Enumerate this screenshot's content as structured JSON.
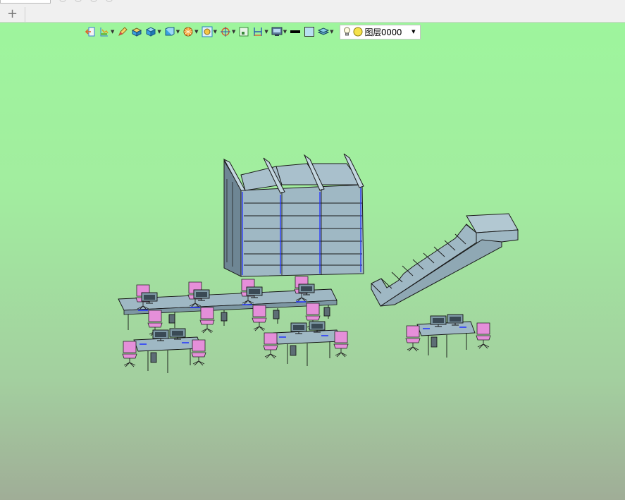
{
  "tabs": {
    "new_tab_label": "+"
  },
  "toolbar": {
    "tools": [
      {
        "icon": "exit-sketch-icon",
        "dropdown": false
      },
      {
        "icon": "feature-tree-icon",
        "dropdown": true
      },
      {
        "icon": "pencil-icon",
        "dropdown": false
      },
      {
        "icon": "box-icon",
        "dropdown": false
      },
      {
        "icon": "solid-cube-icon",
        "dropdown": true
      },
      {
        "icon": "view-cube-icon",
        "dropdown": true
      },
      {
        "icon": "render-sphere-icon",
        "dropdown": true
      },
      {
        "icon": "zoom-fit-icon",
        "dropdown": true
      },
      {
        "icon": "snap-target-icon",
        "dropdown": true
      },
      {
        "icon": "grid-icon",
        "dropdown": false
      },
      {
        "icon": "dimension-icon",
        "dropdown": true
      },
      {
        "icon": "display-settings-icon",
        "dropdown": true
      },
      {
        "icon": "line-color-icon",
        "dropdown": false
      },
      {
        "icon": "fill-color-icon",
        "dropdown": false
      },
      {
        "icon": "layer-stack-icon",
        "dropdown": true
      }
    ],
    "layer": {
      "name": "图层0000",
      "icons": [
        "bulb-icon",
        "color-dot-icon"
      ]
    }
  },
  "colors": {
    "viewport_top": "#9ef59d",
    "viewport_bottom": "#a0ad97",
    "model_fill": "#9fb8c4",
    "model_edge": "#1a1a1a",
    "chair_fill": "#e58fd9",
    "highlight_edge": "#2233ff"
  }
}
